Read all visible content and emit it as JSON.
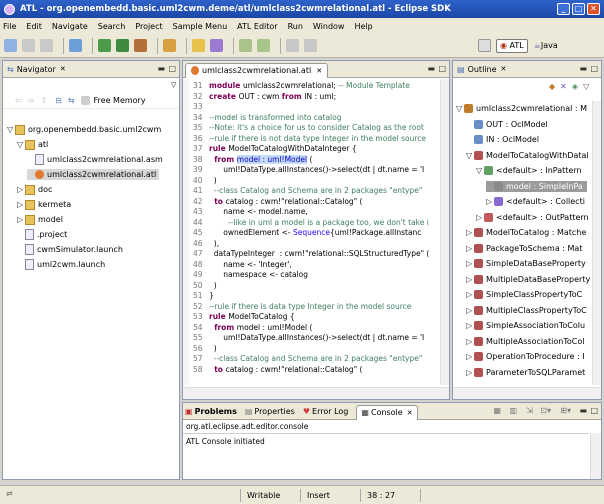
{
  "window": {
    "title": "ATL - org.openembedd.basic.uml2cwm.deme/atl/umlclass2cwmrelational.atl - Eclipse SDK",
    "controls": [
      "_",
      "□",
      "✕"
    ]
  },
  "menu": [
    "File",
    "Edit",
    "Navigate",
    "Search",
    "Project",
    "Sample Menu",
    "ATL Editor",
    "Run",
    "Window",
    "Help"
  ],
  "perspectives": {
    "atl": "ATL",
    "java": "Java"
  },
  "navigator": {
    "tab": "Navigator",
    "free_memory": "Free Memory",
    "items": [
      {
        "label": "org.openembedd.basic.uml2cwm",
        "indent": 0,
        "kind": "project",
        "exp": "▽"
      },
      {
        "label": "atl",
        "indent": 1,
        "kind": "folder",
        "exp": "▽"
      },
      {
        "label": "umlclass2cwmrelational.asm",
        "indent": 2,
        "kind": "file",
        "exp": ""
      },
      {
        "label": "umlclass2cwmrelational.atl",
        "indent": 2,
        "kind": "atl",
        "exp": "",
        "selected": true
      },
      {
        "label": "doc",
        "indent": 1,
        "kind": "folder",
        "exp": "▷"
      },
      {
        "label": "kermeta",
        "indent": 1,
        "kind": "folder",
        "exp": "▷"
      },
      {
        "label": "model",
        "indent": 1,
        "kind": "folder",
        "exp": "▷"
      },
      {
        "label": ".project",
        "indent": 1,
        "kind": "file",
        "exp": ""
      },
      {
        "label": "cwmSimulator.launch",
        "indent": 1,
        "kind": "file",
        "exp": ""
      },
      {
        "label": "uml2cwm.launch",
        "indent": 1,
        "kind": "file",
        "exp": ""
      }
    ]
  },
  "editor": {
    "tab": "umlclass2cwmrelational.atl",
    "lines": [
      {
        "n": "31",
        "parts": [
          [
            "kw",
            "module "
          ],
          [
            "",
            "umlclass2cwmrelational; "
          ],
          [
            "cm",
            "-- Module Template"
          ]
        ]
      },
      {
        "n": "32",
        "parts": [
          [
            "kw",
            "create "
          ],
          [
            "",
            "OUT : cwm "
          ],
          [
            "kw",
            "from "
          ],
          [
            "",
            "IN : uml;"
          ]
        ]
      },
      {
        "n": "33",
        "parts": [
          [
            "",
            ""
          ]
        ]
      },
      {
        "n": "34",
        "parts": [
          [
            "cm",
            "--model is transformed into catalog"
          ]
        ]
      },
      {
        "n": "35",
        "parts": [
          [
            "cm",
            "--Note: it's a choice for us to consider Catalog as the root"
          ]
        ]
      },
      {
        "n": "36",
        "parts": [
          [
            "cm",
            "--rule if there is not data type Integer in the model source"
          ]
        ]
      },
      {
        "n": "37",
        "parts": [
          [
            "kw",
            "rule "
          ],
          [
            "",
            "ModelToCatalogWithDataInteger {"
          ]
        ]
      },
      {
        "n": "38",
        "parts": [
          [
            "kw",
            "  from "
          ],
          [
            "hl",
            "model : uml!Model"
          ],
          [
            "",
            " ("
          ]
        ]
      },
      {
        "n": "39",
        "parts": [
          [
            "",
            "      uml!DataType.allInstances()->select(dt | dt.name = 'I"
          ]
        ]
      },
      {
        "n": "40",
        "parts": [
          [
            "",
            "  )"
          ]
        ]
      },
      {
        "n": "41",
        "parts": [
          [
            "cm",
            "  --class Catalog and Schema are in 2 packages \"entype\""
          ]
        ]
      },
      {
        "n": "42",
        "parts": [
          [
            "kw",
            "  to "
          ],
          [
            "",
            "catalog : cwm!\"relational::Catalog\" ("
          ]
        ]
      },
      {
        "n": "43",
        "parts": [
          [
            "",
            "      name <- model.name,"
          ]
        ]
      },
      {
        "n": "44",
        "parts": [
          [
            "cm",
            "        --like in uml a model is a package too, we don't take i"
          ]
        ]
      },
      {
        "n": "45",
        "parts": [
          [
            "",
            "      ownedElement <- "
          ],
          [
            "st",
            "Sequence"
          ],
          [
            "",
            "{uml!Package.allInstanc"
          ]
        ]
      },
      {
        "n": "46",
        "parts": [
          [
            "",
            "  ),"
          ]
        ]
      },
      {
        "n": "47",
        "parts": [
          [
            "",
            "  dataTypeInteger  : cwm!\"relational::SQLStructuredType\" ("
          ]
        ]
      },
      {
        "n": "48",
        "parts": [
          [
            "",
            "      name <- 'Integer',"
          ]
        ]
      },
      {
        "n": "49",
        "parts": [
          [
            "",
            "      namespace <- catalog"
          ]
        ]
      },
      {
        "n": "50",
        "parts": [
          [
            "",
            "  )"
          ]
        ]
      },
      {
        "n": "51",
        "parts": [
          [
            "",
            "}"
          ]
        ]
      },
      {
        "n": "52",
        "parts": [
          [
            "cm",
            "--rule if there is data type Integer in the model source"
          ]
        ]
      },
      {
        "n": "53",
        "parts": [
          [
            "kw",
            "rule "
          ],
          [
            "",
            "ModelToCatalog {"
          ]
        ]
      },
      {
        "n": "54",
        "parts": [
          [
            "kw",
            "  from "
          ],
          [
            "",
            "model : uml!Model ("
          ]
        ]
      },
      {
        "n": "55",
        "parts": [
          [
            "",
            "      uml!DataType.allInstances()->select(dt | dt.name = 'I"
          ]
        ]
      },
      {
        "n": "56",
        "parts": [
          [
            "",
            "  )"
          ]
        ]
      },
      {
        "n": "57",
        "parts": [
          [
            "cm",
            "  --class Catalog and Schema are in 2 packages \"entype\""
          ]
        ]
      },
      {
        "n": "58",
        "parts": [
          [
            "kw",
            "  to "
          ],
          [
            "",
            "catalog : cwm!\"relational::Catalog\" ("
          ]
        ]
      }
    ]
  },
  "outline": {
    "tab": "Outline",
    "items": [
      {
        "label": "umlclass2cwmrelational : M",
        "indent": 0,
        "exp": "▽",
        "c": "#c07a2a"
      },
      {
        "label": "OUT : OclModel",
        "indent": 1,
        "exp": "",
        "c": "#6a8cc8"
      },
      {
        "label": "IN : OclModel",
        "indent": 1,
        "exp": "",
        "c": "#6a8cc8"
      },
      {
        "label": "ModelToCatalogWithDatal",
        "indent": 1,
        "exp": "▽",
        "c": "#b05050"
      },
      {
        "label": "<default> : InPattern",
        "indent": 2,
        "exp": "▽",
        "c": "#60a060"
      },
      {
        "label": "model : SimpleInPa",
        "indent": 3,
        "exp": "",
        "c": "#8a8a8a",
        "selected": true
      },
      {
        "label": "<default> : Collecti",
        "indent": 3,
        "exp": "▷",
        "c": "#8a6ad0"
      },
      {
        "label": "<default> : OutPattern",
        "indent": 2,
        "exp": "▷",
        "c": "#c05a5a"
      },
      {
        "label": "ModelToCatalog : Matche",
        "indent": 1,
        "exp": "▷",
        "c": "#b05050"
      },
      {
        "label": "PackageToSchema : Mat",
        "indent": 1,
        "exp": "▷",
        "c": "#b05050"
      },
      {
        "label": "SimpleDataBaseProperty",
        "indent": 1,
        "exp": "▷",
        "c": "#b05050"
      },
      {
        "label": "MultipleDataBaseProperty",
        "indent": 1,
        "exp": "▷",
        "c": "#b05050"
      },
      {
        "label": "SimpleClassPropertyToC",
        "indent": 1,
        "exp": "▷",
        "c": "#b05050"
      },
      {
        "label": "MultipleClassPropertyToC",
        "indent": 1,
        "exp": "▷",
        "c": "#b05050"
      },
      {
        "label": "SimpleAssociationToColu",
        "indent": 1,
        "exp": "▷",
        "c": "#b05050"
      },
      {
        "label": "MultipleAssociationToCol",
        "indent": 1,
        "exp": "▷",
        "c": "#b05050"
      },
      {
        "label": "OperationToProcedure : I",
        "indent": 1,
        "exp": "▷",
        "c": "#b05050"
      },
      {
        "label": "ParameterToSQLParamet",
        "indent": 1,
        "exp": "▷",
        "c": "#b05050"
      }
    ]
  },
  "console": {
    "tabs": [
      "Problems",
      "Properties",
      "Error Log",
      "Console"
    ],
    "source": "org.atl.eclipse.adt.editor.console",
    "text": "ATL Console initiated"
  },
  "status": {
    "mode": "Writable",
    "insert": "Insert",
    "position": "38 : 27"
  }
}
